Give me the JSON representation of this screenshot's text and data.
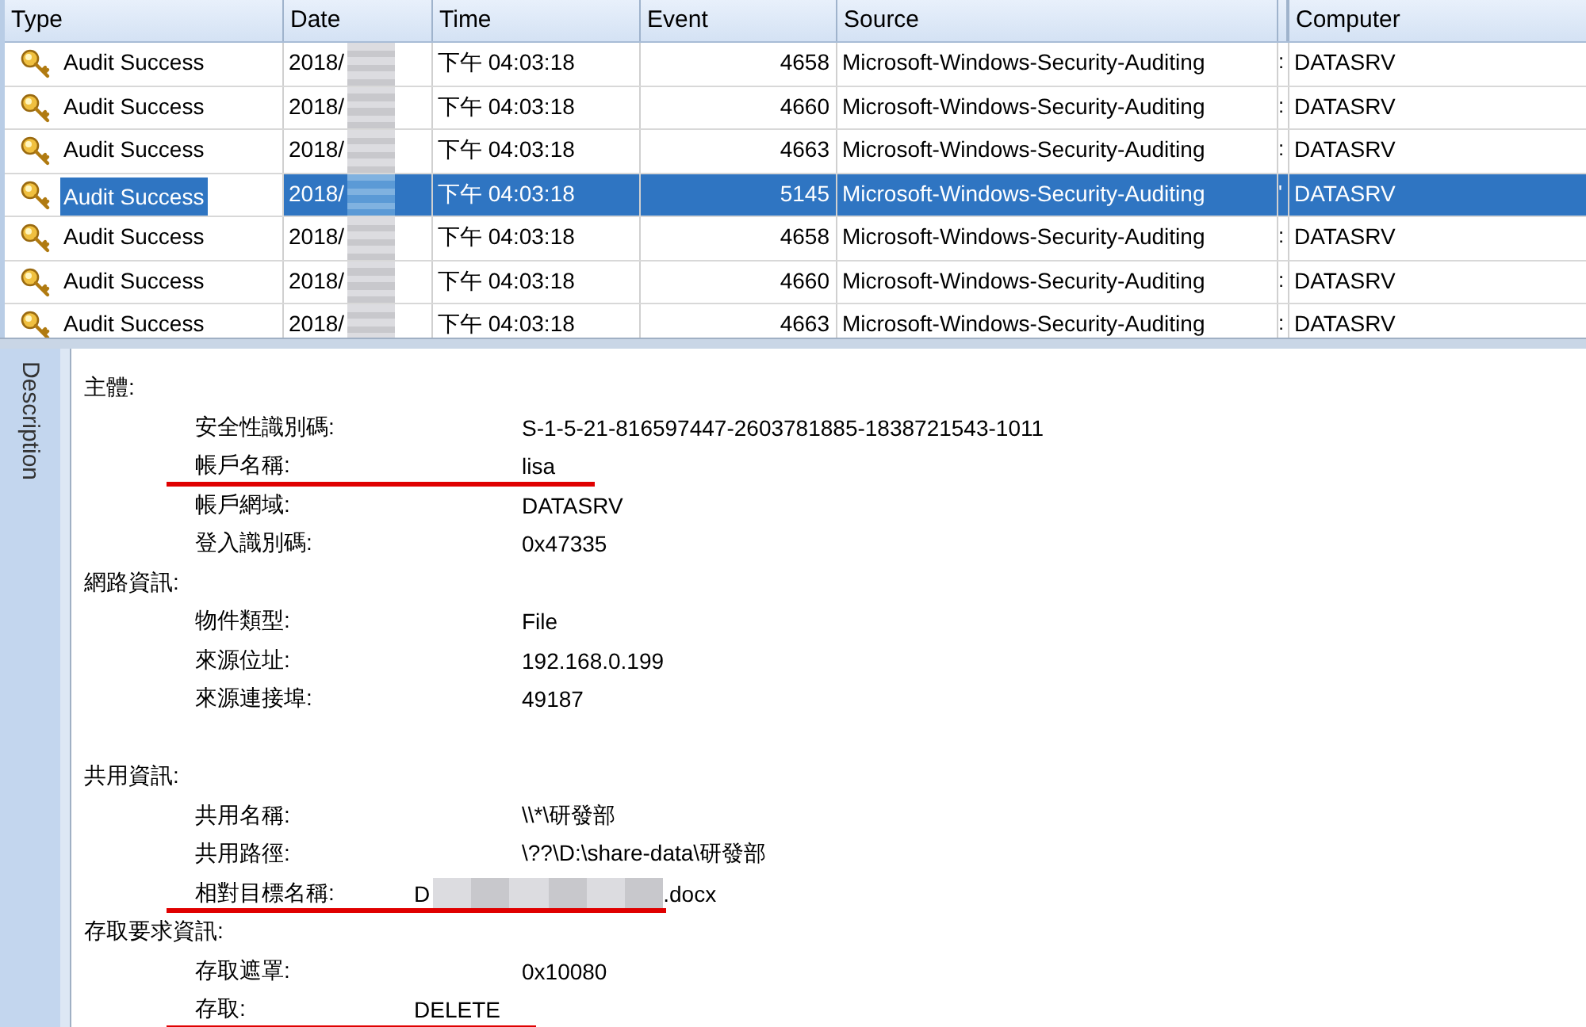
{
  "table": {
    "columns": [
      "Type",
      "Date",
      "Time",
      "Event",
      "Source",
      "",
      "Computer"
    ],
    "rows": [
      {
        "type": "Audit Success",
        "date": "2018/",
        "time": "下午 04:03:18",
        "event": "4658",
        "source": "Microsoft-Windows-Security-Auditing",
        "column_6": ":",
        "computer": "DATASRV",
        "selected": false
      },
      {
        "type": "Audit Success",
        "date": "2018/",
        "time": "下午 04:03:18",
        "event": "4660",
        "source": "Microsoft-Windows-Security-Auditing",
        "column_6": ":",
        "computer": "DATASRV",
        "selected": false
      },
      {
        "type": "Audit Success",
        "date": "2018/",
        "time": "下午 04:03:18",
        "event": "4663",
        "source": "Microsoft-Windows-Security-Auditing",
        "column_6": ":",
        "computer": "DATASRV",
        "selected": false
      },
      {
        "type": "Audit Success",
        "date": "2018/",
        "time": "下午 04:03:18",
        "event": "5145",
        "source": "Microsoft-Windows-Security-Auditing",
        "column_6": "'",
        "computer": "DATASRV",
        "selected": true
      },
      {
        "type": "Audit Success",
        "date": "2018/",
        "time": "下午 04:03:18",
        "event": "4658",
        "source": "Microsoft-Windows-Security-Auditing",
        "column_6": ":",
        "computer": "DATASRV",
        "selected": false
      },
      {
        "type": "Audit Success",
        "date": "2018/",
        "time": "下午 04:03:18",
        "event": "4660",
        "source": "Microsoft-Windows-Security-Auditing",
        "column_6": ":",
        "computer": "DATASRV",
        "selected": false
      },
      {
        "type": "Audit Success",
        "date": "2018/",
        "time": "下午 04:03:18",
        "event": "4663",
        "source": "Microsoft-Windows-Security-Auditing",
        "column_6": ":",
        "computer": "DATASRV",
        "selected": false
      }
    ]
  },
  "description": {
    "tab": "Description",
    "lines": [
      {
        "kind": "heading",
        "label": "主體:"
      },
      {
        "kind": "field",
        "label": "安全性識別碼:",
        "value": "S-1-5-21-816597447-2603781885-1838721543-1011"
      },
      {
        "kind": "field",
        "label": "帳戶名稱:",
        "value": "lisa",
        "underlined": true
      },
      {
        "kind": "field",
        "label": "帳戶網域:",
        "value": "DATASRV"
      },
      {
        "kind": "field",
        "label": "登入識別碼:",
        "value": "0x47335"
      },
      {
        "kind": "heading",
        "label": "網路資訊:"
      },
      {
        "kind": "field",
        "label": "物件類型:",
        "value": "File"
      },
      {
        "kind": "field",
        "label": "來源位址:",
        "value": "192.168.0.199"
      },
      {
        "kind": "field",
        "label": "來源連接埠:",
        "value": "49187"
      },
      {
        "kind": "blank"
      },
      {
        "kind": "heading",
        "label": "共用資訊:"
      },
      {
        "kind": "field",
        "label": "共用名稱:",
        "value": "\\\\*\\研發部"
      },
      {
        "kind": "field",
        "label": "共用路徑:",
        "value": "\\??\\D:\\share-data\\研發部"
      },
      {
        "kind": "short",
        "label": "相對目標名稱:",
        "value": "D",
        "value_end": ".docx",
        "underlined": true
      },
      {
        "kind": "heading",
        "label": "存取要求資訊:"
      },
      {
        "kind": "field",
        "label": "存取遮罩:",
        "value": "0x10080"
      },
      {
        "kind": "short",
        "label": "存取:",
        "value": "DELETE",
        "underlined": true
      }
    ]
  }
}
